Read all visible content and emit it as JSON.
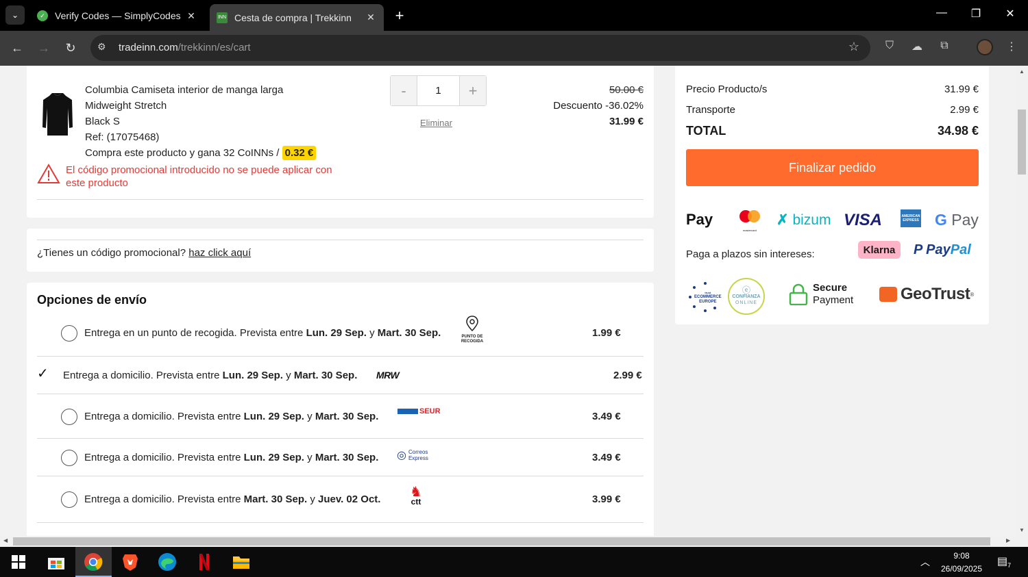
{
  "browser": {
    "tabs": [
      {
        "title": "Verify Codes — SimplyCodes",
        "active": false,
        "icon": "simplycodes-icon"
      },
      {
        "title": "Cesta de compra | Trekkinn",
        "active": true,
        "icon": "trekkinn-icon"
      }
    ],
    "url_domain": "tradeinn.com",
    "url_path": "/trekkinn/es/cart"
  },
  "product": {
    "name_line1": "Columbia Camiseta interior de manga larga",
    "name_line2": "Midweight Stretch",
    "variant": "Black S",
    "ref": "Ref: (17075468)",
    "coins_text": "Compra este producto y gana 32 CoINNs /",
    "coins_value": "0.32 €",
    "quantity": "1",
    "qty_minus": "-",
    "qty_plus": "+",
    "remove_label": "Eliminar",
    "old_price": "50.00 €",
    "discount": "Descuento -36.02%",
    "new_price": "31.99 €",
    "promo_error": "El código promocional introducido no se puede aplicar con este producto"
  },
  "promo": {
    "question": "¿Tienes un código promocional?",
    "link": "haz click aquí"
  },
  "shipping": {
    "title": "Opciones de envío",
    "options": [
      {
        "pre": "Entrega en un punto de recogida. Prevista entre ",
        "d1": "Lun. 29 Sep.",
        "mid": " y ",
        "d2": "Mart. 30 Sep.",
        "price": "1.99 €",
        "carrier": "PUNTO DE RECOGIDA",
        "selected": false
      },
      {
        "pre": "Entrega a domicilio. Prevista entre ",
        "d1": "Lun. 29 Sep.",
        "mid": " y ",
        "d2": "Mart. 30 Sep.",
        "price": "2.99 €",
        "carrier": "MRW",
        "selected": true
      },
      {
        "pre": "Entrega a domicilio. Prevista entre ",
        "d1": "Lun. 29 Sep.",
        "mid": " y ",
        "d2": "Mart. 30 Sep.",
        "price": "3.49 €",
        "carrier": "SEUR",
        "selected": false
      },
      {
        "pre": "Entrega a domicilio. Prevista entre ",
        "d1": "Lun. 29 Sep.",
        "mid": " y ",
        "d2": "Mart. 30 Sep.",
        "price": "3.49 €",
        "carrier": "Correos Express",
        "selected": false
      },
      {
        "pre": "Entrega a domicilio. Prevista entre ",
        "d1": "Mart. 30 Sep.",
        "mid": " y ",
        "d2": "Juev. 02 Oct.",
        "price": "3.99 €",
        "carrier": "ctt",
        "selected": false
      }
    ]
  },
  "summary": {
    "product_label": "Precio Producto/s",
    "product_value": "31.99 €",
    "shipping_label": "Transporte",
    "shipping_value": "2.99 €",
    "total_label": "TOTAL",
    "total_value": "34.98 €",
    "checkout_label": "Finalizar pedido",
    "installments_label": "Paga a plazos sin intereses:",
    "klarna": "Klarna",
    "paypal_a": "Pay",
    "paypal_b": "Pal",
    "applepay": "Pay",
    "bizum": "bizum",
    "visa": "VISA",
    "gpay_g": "G",
    "gpay": "Pay",
    "mastercard": "mastercard",
    "amex": "AMERICAN EXPRESS",
    "trusted_line1": "ECOMMERCE",
    "trusted_line2": "EUROPE",
    "trusted_small": "trust",
    "confianza_line1": "CONFIANZA",
    "confianza_line2": "ONLINE",
    "secure_line1": "Secure",
    "secure_line2": "Payment",
    "geotrust": "GeoTrust",
    "geotrust_mark": "®"
  },
  "carrier_labels": {
    "punto": "PUNTO DE",
    "recogida": "RECOGIDA",
    "mrw": "MRW",
    "seur": "SEUR",
    "correos_a": "Correos",
    "correos_b": "Express",
    "ctt": "ctt"
  },
  "taskbar": {
    "time": "9:08",
    "date": "26/09/2025",
    "notifications": "7"
  },
  "colors": {
    "accent": "#ff6b2c",
    "error": "#e53935",
    "coin": "#ffd400"
  }
}
